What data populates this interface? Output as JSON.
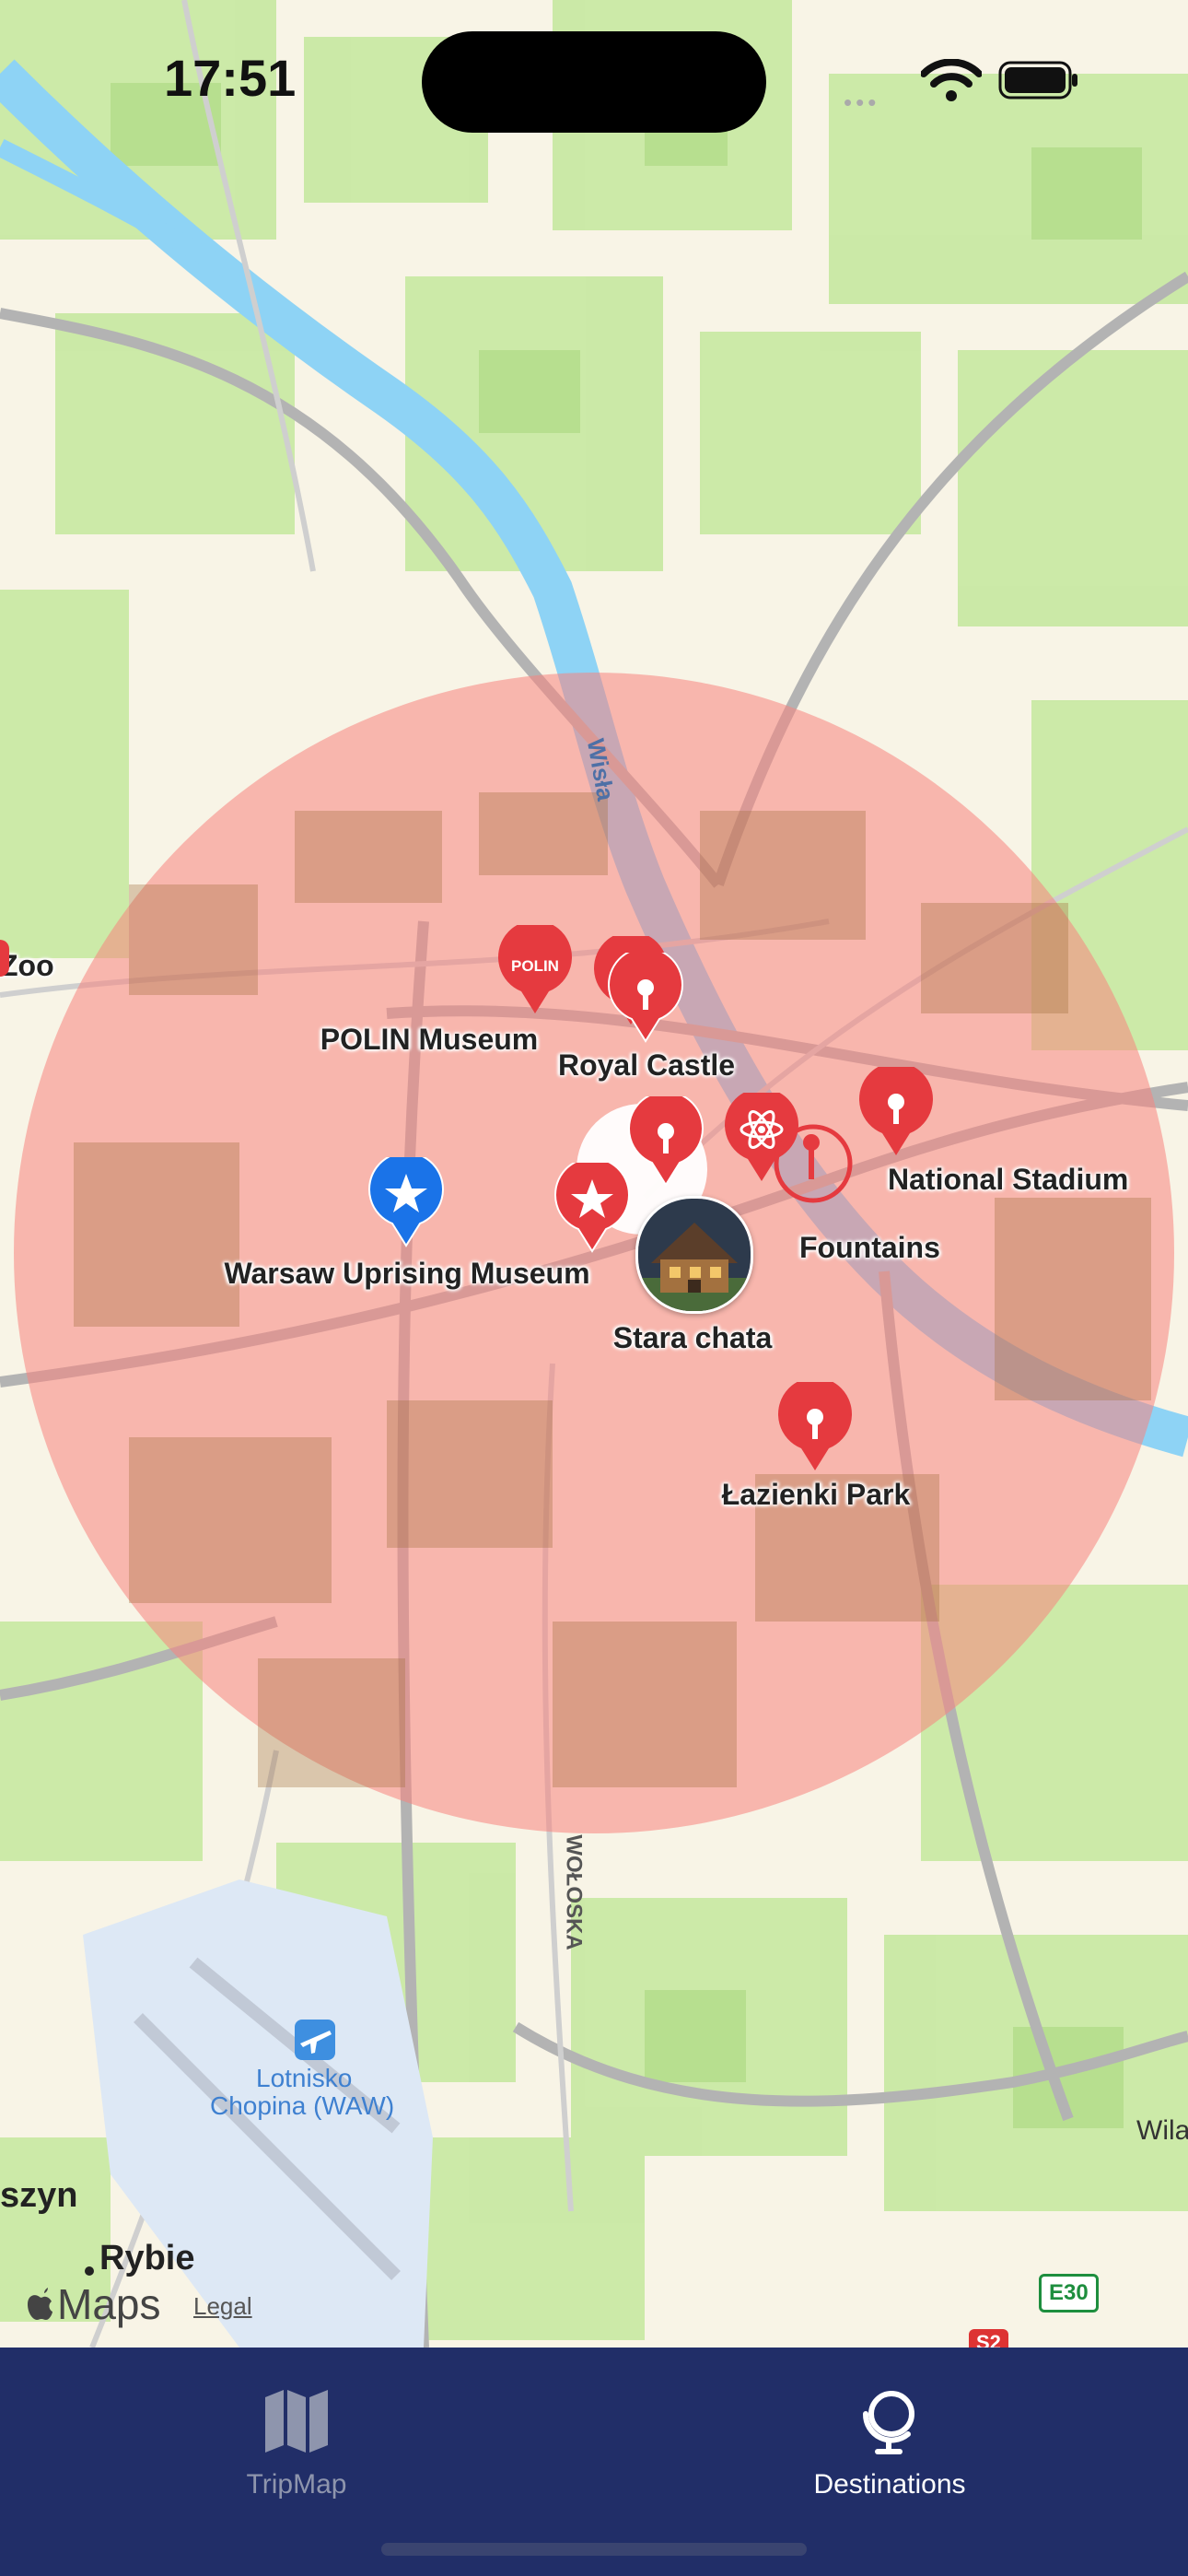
{
  "status_bar": {
    "time": "17:51"
  },
  "map": {
    "river_label": "Wisła",
    "street_label": "WOŁOSKA",
    "airport_label_line1": "Lotnisko",
    "airport_label_line2": "Chopina (WAW)",
    "places": [
      "Zoo",
      "Rybie",
      "szyn",
      "Wila"
    ],
    "road_badges": [
      "E30",
      "S2"
    ],
    "attribution": "Maps",
    "legal": "Legal",
    "circle_color": "#f7847e"
  },
  "pins": [
    {
      "name": "POLIN Museum",
      "icon": "polin-logo-icon",
      "color": "#e53a3f"
    },
    {
      "name": "Royal Castle",
      "icon": "pin-icon",
      "color": "#e53a3f"
    },
    {
      "name": "National Stadium",
      "icon": "pin-icon",
      "color": "#e53a3f"
    },
    {
      "name": "Warsaw Uprising Museum",
      "icon": "star-icon",
      "color": "#1a73e8"
    },
    {
      "name": "Fountains",
      "icon": "pin-outline-icon",
      "color": "#e53a3f"
    },
    {
      "name": "Stara chata",
      "icon": "house-photo",
      "color": "#6b4a2f"
    },
    {
      "name": "Łazienki Park",
      "icon": "pin-icon",
      "color": "#e53a3f"
    }
  ],
  "polin_badge_text": "POLIN",
  "tabbar": {
    "tabs": [
      {
        "label": "TripMap",
        "icon": "map-icon",
        "active": false
      },
      {
        "label": "Destinations",
        "icon": "globe-icon",
        "active": true
      }
    ]
  }
}
